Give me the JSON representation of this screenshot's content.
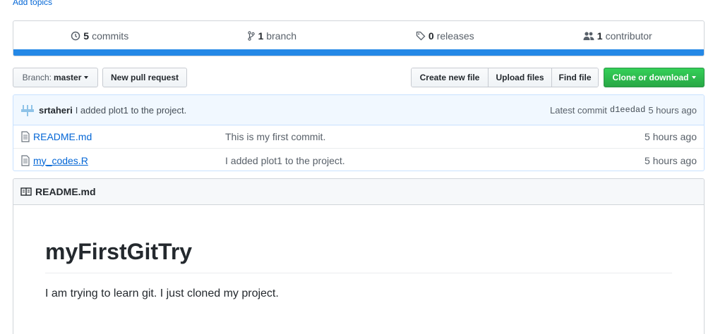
{
  "topics": {
    "add_label": "Add topics"
  },
  "summary": {
    "commits": {
      "count": "5",
      "label": "commits"
    },
    "branches": {
      "count": "1",
      "label": "branch"
    },
    "releases": {
      "count": "0",
      "label": "releases"
    },
    "contributors": {
      "count": "1",
      "label": "contributor"
    }
  },
  "language_bar": {
    "color": "#2488e6"
  },
  "toolbar": {
    "branch_prefix": "Branch:",
    "branch_name": "master",
    "new_pull_request": "New pull request",
    "create_new_file": "Create new file",
    "upload_files": "Upload files",
    "find_file": "Find file",
    "clone_or_download": "Clone or download"
  },
  "latest_commit": {
    "author": "srtaheri",
    "message": "I added plot1 to the project.",
    "label": "Latest commit",
    "sha": "d1eedad",
    "age": "5 hours ago"
  },
  "files": [
    {
      "name": "README.md",
      "message": "This is my first commit.",
      "age": "5 hours ago"
    },
    {
      "name": "my_codes.R",
      "message": "I added plot1 to the project.",
      "age": "5 hours ago"
    }
  ],
  "readme": {
    "header": "README.md",
    "title": "myFirstGitTry",
    "body": "I am trying to learn git. I just cloned my project."
  },
  "colors": {
    "link": "#0366d6",
    "clone_button": "#28a745"
  }
}
